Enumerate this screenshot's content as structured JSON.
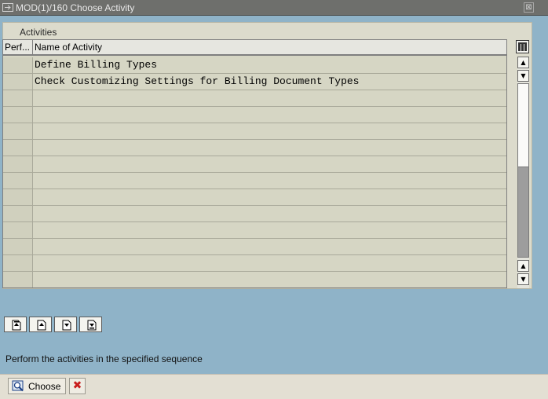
{
  "window": {
    "title": "MOD(1)/160 Choose Activity",
    "close_glyph": "⊠"
  },
  "group": {
    "label": "Activities"
  },
  "table": {
    "columns": [
      "Perf...",
      "Name of Activity"
    ],
    "rows": [
      {
        "perf": "",
        "name": "Define Billing Types"
      },
      {
        "perf": "",
        "name": "Check Customizing Settings for Billing Document Types"
      },
      {
        "perf": "",
        "name": ""
      },
      {
        "perf": "",
        "name": ""
      },
      {
        "perf": "",
        "name": ""
      },
      {
        "perf": "",
        "name": ""
      },
      {
        "perf": "",
        "name": ""
      },
      {
        "perf": "",
        "name": ""
      },
      {
        "perf": "",
        "name": ""
      },
      {
        "perf": "",
        "name": ""
      },
      {
        "perf": "",
        "name": ""
      },
      {
        "perf": "",
        "name": ""
      },
      {
        "perf": "",
        "name": ""
      },
      {
        "perf": "",
        "name": ""
      }
    ]
  },
  "nav_buttons": [
    "first-page-icon",
    "previous-page-icon",
    "next-page-icon",
    "last-page-icon"
  ],
  "hint": "Perform the activities in the specified sequence",
  "footer": {
    "choose_label": "Choose",
    "choose_icon": "magnifier-check-icon",
    "cancel_icon": "cancel-x-icon",
    "cancel_glyph": "✖"
  }
}
